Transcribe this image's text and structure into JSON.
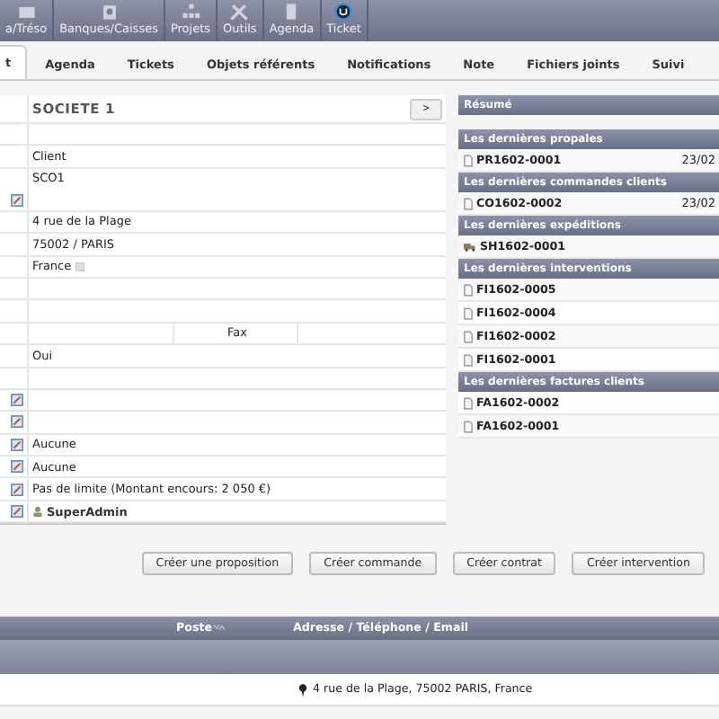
{
  "top_menu": [
    {
      "label": "a/Tréso"
    },
    {
      "label": "Banques/Caisses"
    },
    {
      "label": "Projets"
    },
    {
      "label": "Outils"
    },
    {
      "label": "Agenda"
    },
    {
      "label": "Ticket"
    }
  ],
  "tabs": [
    {
      "label": "t",
      "selected": true
    },
    {
      "label": "Agenda",
      "selected": false
    },
    {
      "label": "Tickets",
      "selected": false
    },
    {
      "label": "Objets référents",
      "selected": false
    },
    {
      "label": "Notifications",
      "selected": false
    },
    {
      "label": "Note",
      "selected": false
    },
    {
      "label": "Fichiers joints",
      "selected": false
    },
    {
      "label": "Suivi",
      "selected": false
    }
  ],
  "company": {
    "name": "SOCIETE 1",
    "next_button": ">"
  },
  "fields": [
    {
      "kind": "text",
      "edit": false
    },
    {
      "kind": "text",
      "value": "Client",
      "edit": false
    },
    {
      "kind": "tall",
      "value": "SCO1",
      "edit": true
    },
    {
      "kind": "text",
      "value": "4 rue de la Plage",
      "edit": false
    },
    {
      "kind": "text",
      "value": "75002 / PARIS",
      "edit": false
    },
    {
      "kind": "country",
      "value": "France",
      "edit": false
    },
    {
      "kind": "text",
      "edit": false
    },
    {
      "kind": "text",
      "edit": false
    },
    {
      "kind": "split",
      "value": "Fax",
      "edit": false
    },
    {
      "kind": "text",
      "value": "Oui",
      "edit": false
    },
    {
      "kind": "text",
      "edit": false
    },
    {
      "kind": "text",
      "edit": true
    },
    {
      "kind": "text",
      "edit": true
    },
    {
      "kind": "text",
      "value": "Aucune",
      "edit": true
    },
    {
      "kind": "text",
      "value": "Aucune",
      "edit": true
    },
    {
      "kind": "text",
      "value": "Pas de limite (Montant encours: 2 050 €)",
      "edit": true
    },
    {
      "kind": "user",
      "value": "SuperAdmin",
      "edit": true
    }
  ],
  "summary": {
    "title": "Résumé"
  },
  "sections": [
    {
      "title": "Les dernières propales",
      "items": [
        {
          "kind": "document",
          "ref": "PR1602-0001",
          "date": "23/02"
        }
      ]
    },
    {
      "title": "Les dernières commandes clients",
      "items": [
        {
          "kind": "document",
          "ref": "CO1602-0002",
          "date": "23/02"
        }
      ]
    },
    {
      "title": "Les dernières expéditions",
      "items": [
        {
          "kind": "shipment",
          "ref": "SH1602-0001"
        }
      ]
    },
    {
      "title": "Les dernières interventions",
      "items": [
        {
          "kind": "document",
          "ref": "FI1602-0005"
        },
        {
          "kind": "document",
          "ref": "FI1602-0004"
        },
        {
          "kind": "document",
          "ref": "FI1602-0002"
        },
        {
          "kind": "document",
          "ref": "FI1602-0001"
        }
      ]
    },
    {
      "title": "Les dernières factures clients",
      "items": [
        {
          "kind": "document",
          "ref": "FA1602-0002"
        },
        {
          "kind": "document",
          "ref": "FA1602-0001"
        }
      ]
    }
  ],
  "actions": [
    "Créer une proposition",
    "Créer commande",
    "Créer contrat",
    "Créer intervention"
  ],
  "contacts": {
    "columns": [
      "Poste",
      "Adresse / Téléphone / Email"
    ],
    "rows": [
      {
        "address": "4 rue de la Plage, 75002 PARIS, France"
      }
    ]
  }
}
